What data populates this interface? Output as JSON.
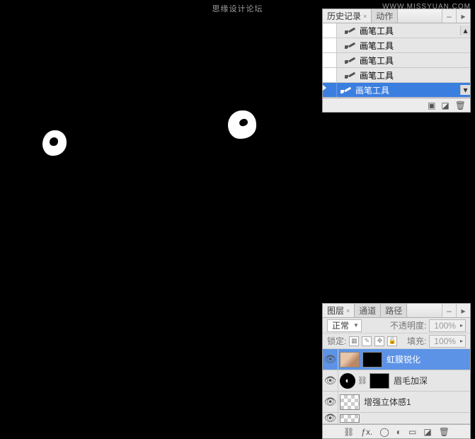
{
  "watermark": {
    "top": "思缘设计论坛",
    "url": "WWW.MISSYUAN.COM"
  },
  "history": {
    "tabs": {
      "main": "历史记录",
      "secondary": "动作"
    },
    "items": [
      {
        "label": "画笔工具"
      },
      {
        "label": "画笔工具"
      },
      {
        "label": "画笔工具"
      },
      {
        "label": "画笔工具"
      },
      {
        "label": "画笔工具"
      }
    ]
  },
  "layers": {
    "tabs": {
      "layers": "图层",
      "channels": "通道",
      "paths": "路径"
    },
    "blend_mode": "正常",
    "opacity_label": "不透明度:",
    "opacity_value": "100%",
    "lock_label": "锁定:",
    "fill_label": "填充:",
    "fill_value": "100%",
    "rows": [
      {
        "name": "虹膜锐化"
      },
      {
        "name": "眉毛加深"
      },
      {
        "name": "增强立体感1"
      }
    ]
  }
}
